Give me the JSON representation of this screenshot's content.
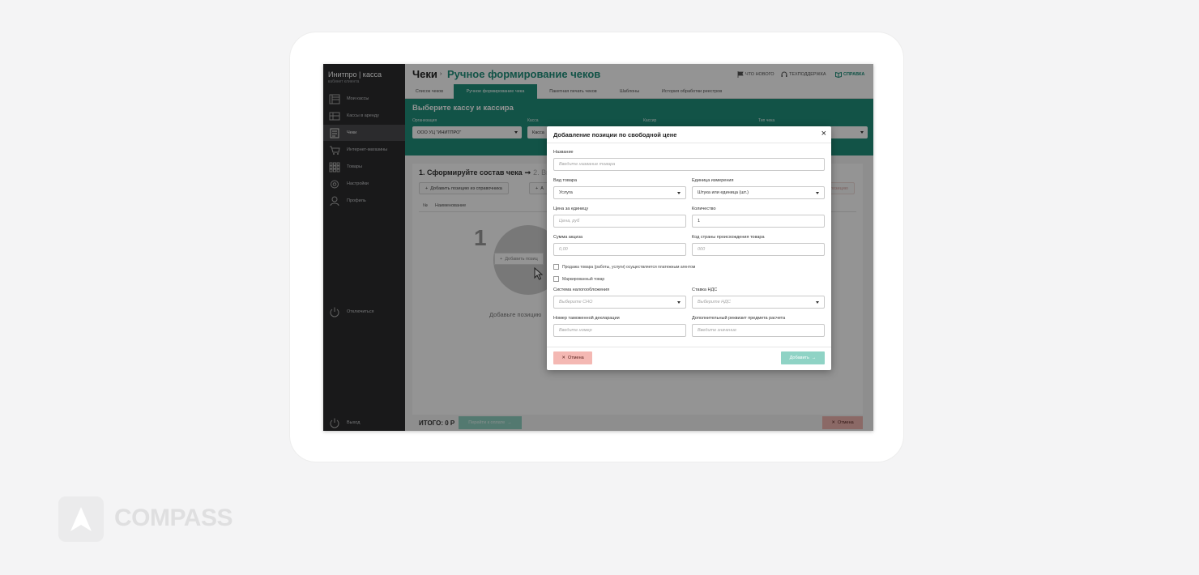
{
  "brand": {
    "name": "Инитпро | касса",
    "subtitle": "кабинет клиента"
  },
  "sidebar": {
    "items": [
      {
        "label": "Мои кассы",
        "icon": "register-icon",
        "active": false
      },
      {
        "label": "Кассы в аренду",
        "icon": "register-rent-icon",
        "active": false
      },
      {
        "label": "Чеки",
        "icon": "receipt-icon",
        "active": true
      },
      {
        "label": "Интернет-магазины",
        "icon": "cart-icon",
        "active": false
      },
      {
        "label": "Товары",
        "icon": "grid-icon",
        "active": false
      },
      {
        "label": "Настройки",
        "icon": "gear-icon",
        "active": false
      },
      {
        "label": "Профиль",
        "icon": "user-icon",
        "active": false
      }
    ],
    "disconnect_label": "Отключиться",
    "logout_label": "Выход"
  },
  "header": {
    "title": "Чеки",
    "separator": "›",
    "subtitle": "Ручное формирование чеков",
    "links": {
      "whats_new": "ЧТО НОВОГО",
      "support": "ТЕХПОДДЕРЖКА",
      "help": "СПРАВКА"
    }
  },
  "tabs": [
    {
      "label": "Список чеков",
      "active": false
    },
    {
      "label": "Ручное формирование чека",
      "active": true
    },
    {
      "label": "Пакетная печать чеков",
      "active": false
    },
    {
      "label": "Шаблоны",
      "active": false
    },
    {
      "label": "История обработки реестров",
      "active": false
    }
  ],
  "selector_panel": {
    "title": "Выберите кассу и кассира",
    "fields": [
      {
        "label": "Организация",
        "value": "ООО УЦ \"ИНИТПРО\""
      },
      {
        "label": "Касса",
        "value": "Касса"
      },
      {
        "label": "Кассир",
        "value": ""
      },
      {
        "label": "Тип чека",
        "value": ""
      }
    ]
  },
  "receipt_builder": {
    "step1": "1. Сформируйте состав чека",
    "step2": "2. Вы",
    "add_from_catalog": "Добавить позицию из справочника",
    "add_other": "А",
    "right_ghost": "позицию",
    "columns": {
      "num": "№",
      "name": "Наименование"
    },
    "big_number": "1",
    "ghost_add": "Добавить позиц",
    "hint": "Добавьте позицию",
    "total": "ИТОГО: 0 Р",
    "next_button": "Перейти к оплате",
    "cancel_button": "Отмена"
  },
  "modal": {
    "title": "Добавление позиции по свободной цене",
    "close": "×",
    "name_label": "Название",
    "name_placeholder": "Введите название товара",
    "type_label": "Вид товара",
    "type_value": "Услуга",
    "unit_label": "Единица измерения",
    "unit_value": "Штука или единица (шт.)",
    "price_label": "Цена за единицу",
    "price_placeholder": "Цена, руб",
    "qty_label": "Количество",
    "qty_value": "1",
    "excise_label": "Сумма акциза",
    "excise_placeholder": "0,00",
    "country_label": "Код страны происхождения товара",
    "country_placeholder": "000",
    "agent_checkbox": "Продажа товара (работы, услуги) осуществляется платежным агентом",
    "marked_checkbox": "Маркированный товар",
    "tax_system_label": "Система налогообложения",
    "tax_system_placeholder": "Выберите СНО",
    "vat_label": "Ставка НДС",
    "vat_placeholder": "Выберите НДС",
    "customs_label": "Номер таможенной декларации",
    "customs_placeholder": "Введите номер",
    "extra_label": "Дополнительный реквизит предмета расчета",
    "extra_placeholder": "Введите значение",
    "cancel": "Отмена",
    "add": "Добавить"
  },
  "watermark": {
    "text": "COMPASS"
  },
  "colors": {
    "accent": "#1f8f7a",
    "sidebar": "#2b2c2e",
    "cancel": "#f4b8b3",
    "add_disabled": "#8fd3c5"
  }
}
